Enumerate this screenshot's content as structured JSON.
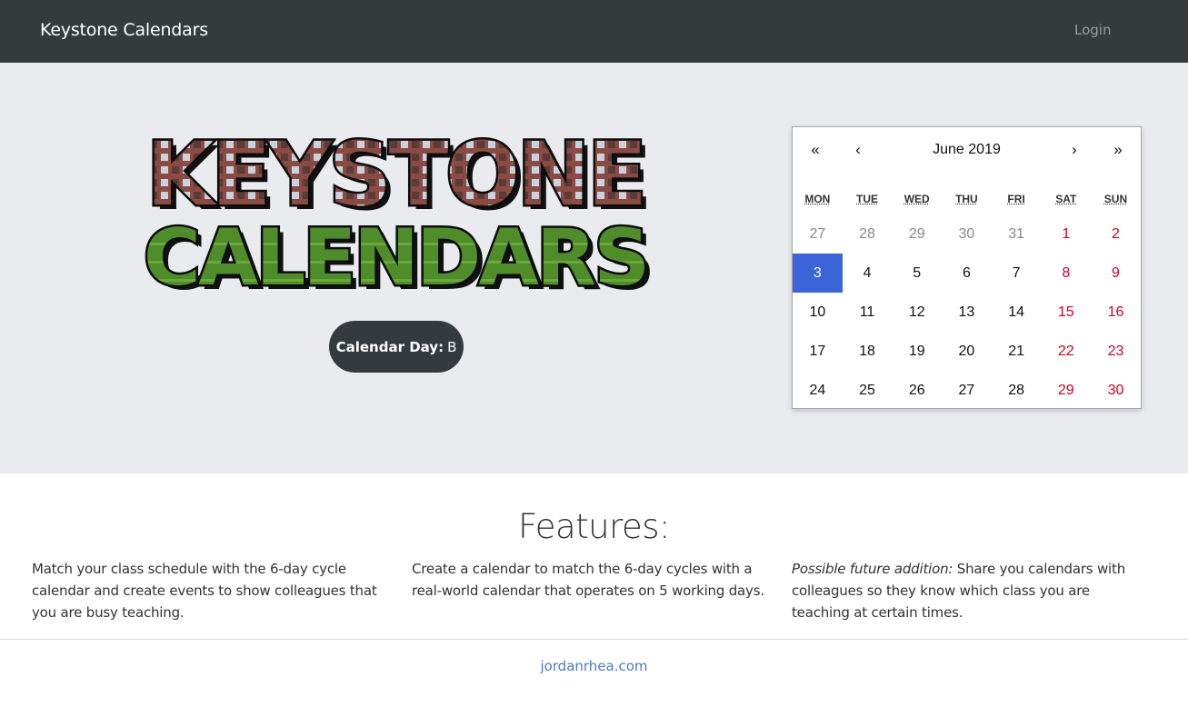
{
  "navbar": {
    "brand": "Keystone Calendars",
    "login": "Login"
  },
  "hero": {
    "logo_lines": [
      "KEYSTONE",
      "CALENDARS"
    ],
    "calendar_day_label": "Calendar Day:",
    "calendar_day_value": "B"
  },
  "calendar": {
    "prev_year": "«",
    "prev_month": "‹",
    "title": "June 2019",
    "next_month": "›",
    "next_year": "»",
    "weekdays": [
      "MON",
      "TUE",
      "WED",
      "THU",
      "FRI",
      "SAT",
      "SUN"
    ],
    "weeks": [
      [
        {
          "d": "27",
          "t": "other"
        },
        {
          "d": "28",
          "t": "other"
        },
        {
          "d": "29",
          "t": "other"
        },
        {
          "d": "30",
          "t": "other"
        },
        {
          "d": "31",
          "t": "other"
        },
        {
          "d": "1",
          "t": "weekend"
        },
        {
          "d": "2",
          "t": "weekend"
        }
      ],
      [
        {
          "d": "3",
          "t": "sel"
        },
        {
          "d": "4",
          "t": ""
        },
        {
          "d": "5",
          "t": ""
        },
        {
          "d": "6",
          "t": ""
        },
        {
          "d": "7",
          "t": ""
        },
        {
          "d": "8",
          "t": "weekend"
        },
        {
          "d": "9",
          "t": "weekend"
        }
      ],
      [
        {
          "d": "10",
          "t": ""
        },
        {
          "d": "11",
          "t": ""
        },
        {
          "d": "12",
          "t": ""
        },
        {
          "d": "13",
          "t": ""
        },
        {
          "d": "14",
          "t": ""
        },
        {
          "d": "15",
          "t": "weekend"
        },
        {
          "d": "16",
          "t": "weekend"
        }
      ],
      [
        {
          "d": "17",
          "t": ""
        },
        {
          "d": "18",
          "t": ""
        },
        {
          "d": "19",
          "t": ""
        },
        {
          "d": "20",
          "t": ""
        },
        {
          "d": "21",
          "t": ""
        },
        {
          "d": "22",
          "t": "weekend"
        },
        {
          "d": "23",
          "t": "weekend"
        }
      ],
      [
        {
          "d": "24",
          "t": ""
        },
        {
          "d": "25",
          "t": ""
        },
        {
          "d": "26",
          "t": ""
        },
        {
          "d": "27",
          "t": ""
        },
        {
          "d": "28",
          "t": ""
        },
        {
          "d": "29",
          "t": "weekend"
        },
        {
          "d": "30",
          "t": "weekend"
        }
      ]
    ],
    "colors": {
      "selected": "#3c64d9",
      "weekend": "#d10023",
      "other_month": "#8a8a8a"
    }
  },
  "features": {
    "title": "Features:",
    "items": [
      {
        "prefix": "",
        "text": "Match your class schedule with the 6-day cycle calendar and create events to show colleagues that you are busy teaching."
      },
      {
        "prefix": "",
        "text": "Create a calendar to match the 6-day cycles with a real-world calendar that operates on 5 working days."
      },
      {
        "prefix": "Possible future addition:",
        "text": " Share you calendars with colleagues so they know which class you are teaching at certain times."
      }
    ]
  },
  "footer": {
    "link": "jordanrhea.com"
  }
}
